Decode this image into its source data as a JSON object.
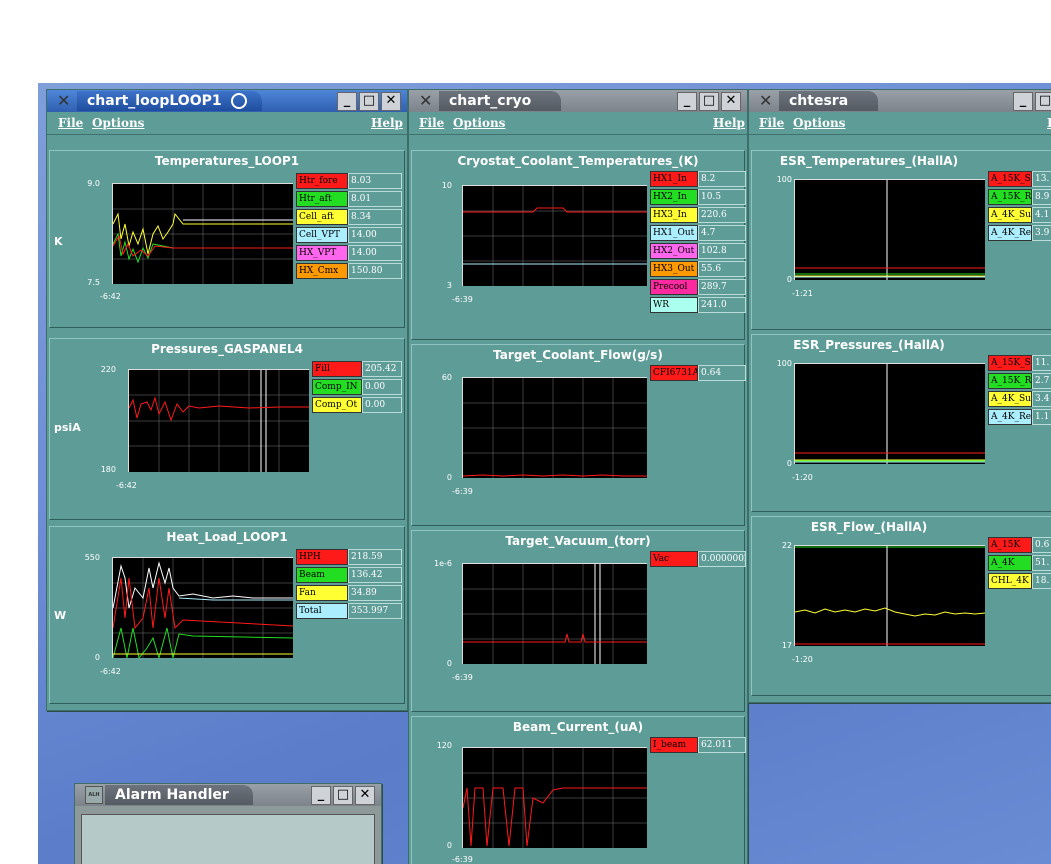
{
  "colors": {
    "red": "#ff1a1a",
    "green": "#22dd22",
    "yellow": "#ffff33",
    "cyan": "#aaeeff",
    "magenta": "#ff66ee",
    "orange": "#ff9900",
    "pink": "#ff2a9f",
    "ltcyan": "#aaffee"
  },
  "windows": {
    "loop": {
      "title": "chart_loopLOOP1",
      "menu": {
        "file": "File",
        "options": "Options",
        "help": "Help"
      },
      "charts": [
        {
          "title": "Temperatures_LOOP1",
          "unit": "K",
          "ymax": "9.0",
          "ymin": "7.5",
          "xlabel": "-6:42",
          "legend": [
            {
              "name": "Htr_fore",
              "value": "8.03",
              "color": "#ff1a1a"
            },
            {
              "name": "Htr_aft",
              "value": "8.01",
              "color": "#22dd22"
            },
            {
              "name": "Cell_aft",
              "value": "8.34",
              "color": "#ffff33"
            },
            {
              "name": "Cell_VPT",
              "value": "14.00",
              "color": "#aaeeff"
            },
            {
              "name": "HX_VPT",
              "value": "14.00",
              "color": "#ff66ee"
            },
            {
              "name": "HX_Cmx",
              "value": "150.80",
              "color": "#ff9900"
            }
          ]
        },
        {
          "title": "Pressures_GASPANEL4",
          "unit": "psiA",
          "ymax": "220",
          "ymin": "180",
          "xlabel": "-6:42",
          "legend": [
            {
              "name": "Fill",
              "value": "205.42",
              "color": "#ff1a1a"
            },
            {
              "name": "Comp_IN",
              "value": "0.00",
              "color": "#22dd22"
            },
            {
              "name": "Comp_Ot",
              "value": "0.00",
              "color": "#ffff33"
            }
          ]
        },
        {
          "title": "Heat_Load_LOOP1",
          "unit": "W",
          "ymax": "550",
          "ymin": "0",
          "xlabel": "-6:42",
          "legend": [
            {
              "name": "HPH",
              "value": "218.59",
              "color": "#ff1a1a"
            },
            {
              "name": "Beam",
              "value": "136.42",
              "color": "#22dd22"
            },
            {
              "name": "Fan",
              "value": "34.89",
              "color": "#ffff33"
            },
            {
              "name": "Total",
              "value": "353.997",
              "color": "#aaeeff"
            }
          ]
        }
      ]
    },
    "cryo": {
      "title": "chart_cryo",
      "menu": {
        "file": "File",
        "options": "Options",
        "help": "Help"
      },
      "charts": [
        {
          "title": "Cryostat_Coolant_Temperatures_(K)",
          "ymax": "10",
          "ymin": "3",
          "xlabel": "-6:39",
          "legend": [
            {
              "name": "HX1_In",
              "value": "8.2",
              "color": "#ff1a1a"
            },
            {
              "name": "HX2_In",
              "value": "10.5",
              "color": "#22dd22"
            },
            {
              "name": "HX3_In",
              "value": "220.6",
              "color": "#ffff33"
            },
            {
              "name": "HX1_Out",
              "value": "4.7",
              "color": "#aaeeff"
            },
            {
              "name": "HX2_Out",
              "value": "102.8",
              "color": "#ff66ee"
            },
            {
              "name": "HX3_Out",
              "value": "55.6",
              "color": "#ff9900"
            },
            {
              "name": "Precool",
              "value": "289.7",
              "color": "#ff2a9f"
            },
            {
              "name": "WR",
              "value": "241.0",
              "color": "#aaffee"
            }
          ]
        },
        {
          "title": "Target_Coolant_Flow(g/s)",
          "ymax": "60",
          "ymin": "0",
          "xlabel": "-6:39",
          "legend": [
            {
              "name": "CFI6731A",
              "value": "0.64",
              "color": "#ff1a1a"
            }
          ]
        },
        {
          "title": "Target_Vacuum_(torr)",
          "ymax": "1e-6",
          "ymin": "0",
          "xlabel": "-6:39",
          "legend": [
            {
              "name": "Vac",
              "value": "0.0000002",
              "color": "#ff1a1a"
            }
          ]
        },
        {
          "title": "Beam_Current_(uA)",
          "ymax": "120",
          "ymin": "0",
          "xlabel": "-6:39",
          "legend": [
            {
              "name": "I_beam",
              "value": "62.011",
              "color": "#ff1a1a"
            }
          ]
        }
      ]
    },
    "esr": {
      "title": "chtesra",
      "menu": {
        "file": "File",
        "options": "Options",
        "help": "H"
      },
      "charts": [
        {
          "title": "ESR_Temperatures_(HallA)",
          "ymax": "100",
          "ymin": "0",
          "xlabel": "-1:21",
          "legend": [
            {
              "name": "A_15K_S",
              "value": "13.",
              "color": "#ff1a1a"
            },
            {
              "name": "A_15K_R",
              "value": "8.9",
              "color": "#22dd22"
            },
            {
              "name": "A_4K_Su",
              "value": "4.1",
              "color": "#ffff33"
            },
            {
              "name": "A_4K_Re",
              "value": "3.9",
              "color": "#aaeeff"
            }
          ]
        },
        {
          "title": "ESR_Pressures_(HallA)",
          "ymax": "100",
          "ymin": "0",
          "xlabel": "-1:20",
          "legend": [
            {
              "name": "A_15K_S",
              "value": "11.",
              "color": "#ff1a1a"
            },
            {
              "name": "A_15K_R",
              "value": "2.7",
              "color": "#22dd22"
            },
            {
              "name": "A_4K_Su",
              "value": "3.4",
              "color": "#ffff33"
            },
            {
              "name": "A_4K_Re",
              "value": "1.1",
              "color": "#aaeeff"
            }
          ]
        },
        {
          "title": "ESR_Flow_(HallA)",
          "ymax": "22",
          "ymin": "17",
          "xlabel": "-1:20",
          "legend": [
            {
              "name": "A_15K",
              "value": "0.6",
              "color": "#ff1a1a"
            },
            {
              "name": "A_4K",
              "value": "51.",
              "color": "#22dd22"
            },
            {
              "name": "CHL_4K",
              "value": "18.",
              "color": "#ffff33"
            }
          ]
        }
      ]
    },
    "alarm": {
      "title": "Alarm Handler",
      "icon_text": "ALH"
    }
  }
}
